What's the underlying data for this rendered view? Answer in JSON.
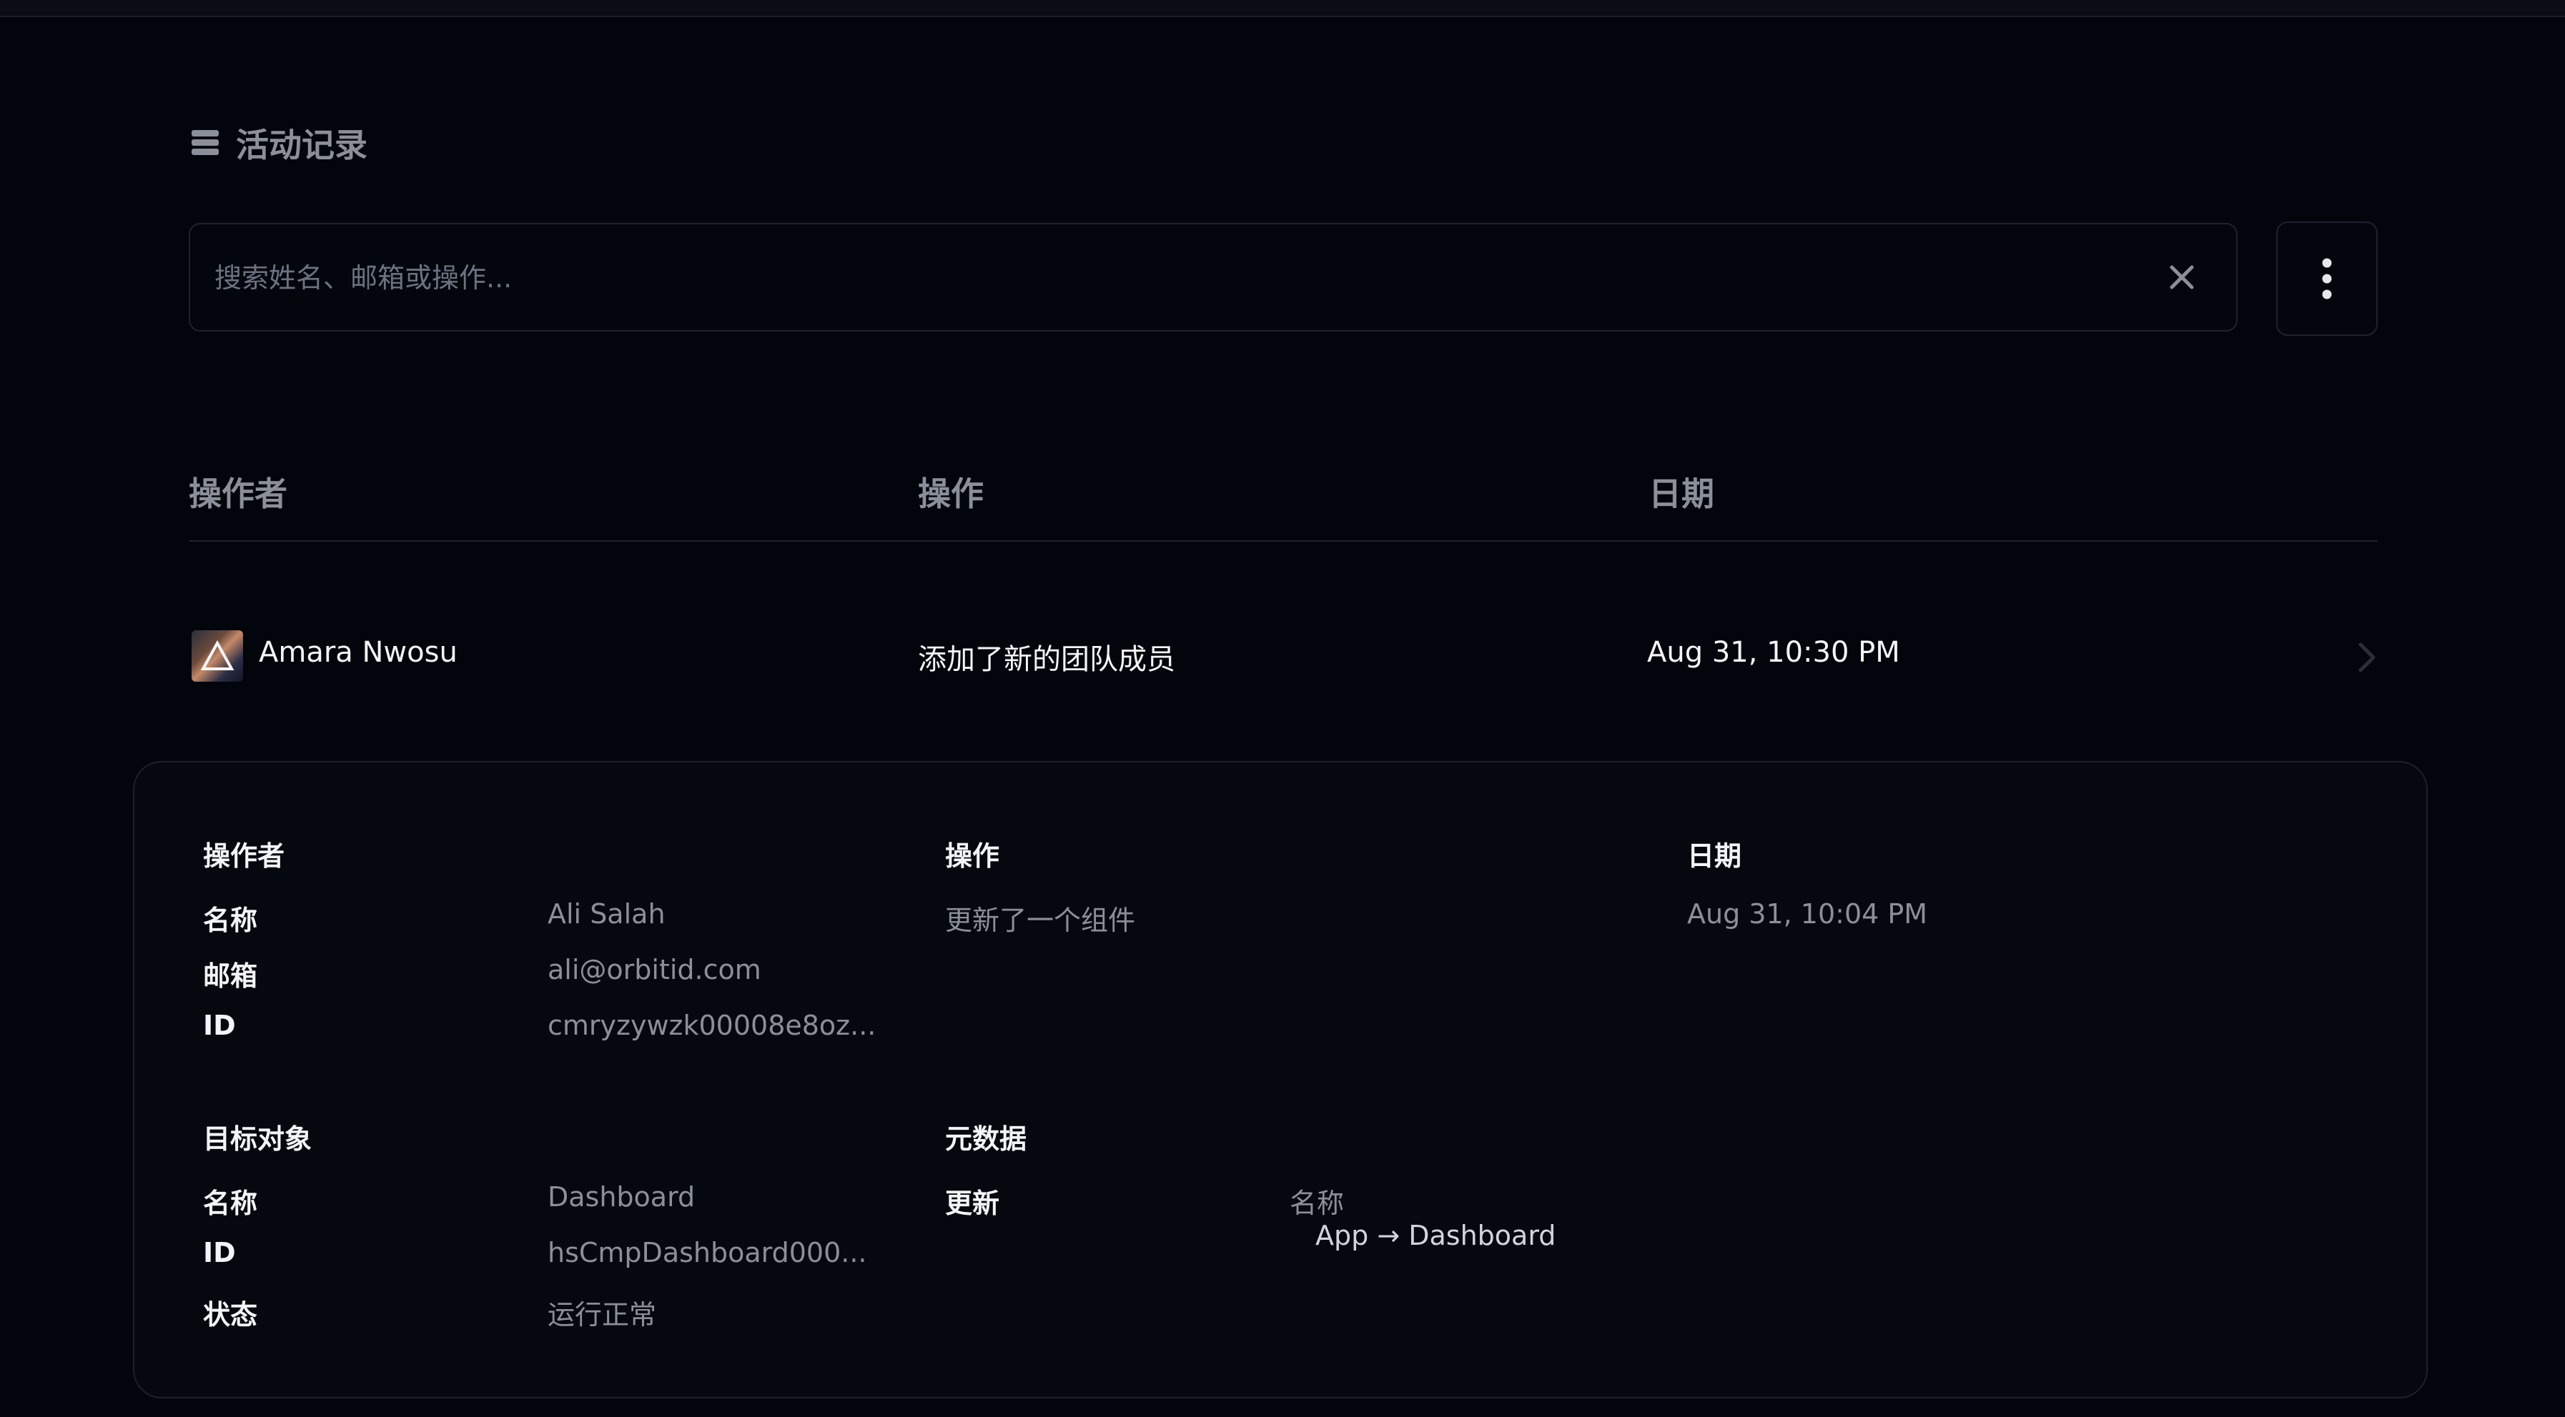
{
  "header": {
    "title": "活动记录",
    "icon": "database-icon"
  },
  "search": {
    "placeholder": "搜索姓名、邮箱或操作...",
    "value": "",
    "clear_icon": "close-icon"
  },
  "toolbar": {
    "more_icon": "more-vertical-icon"
  },
  "table": {
    "columns": [
      "操作者",
      "操作",
      "日期"
    ],
    "rows": [
      {
        "actor": "Amara Nwosu",
        "action": "添加了新的团队成员",
        "date": "Aug 31, 10:30 PM",
        "expand_icon": "chevron-right-icon"
      }
    ]
  },
  "detail": {
    "actor": {
      "heading": "操作者",
      "name_label": "名称",
      "name": "Ali Salah",
      "email_label": "邮箱",
      "email": "ali@orbitid.com",
      "id_label": "ID",
      "id": "cmryzywzk00008e8oz..."
    },
    "action": {
      "heading": "操作",
      "value": "更新了一个组件"
    },
    "date": {
      "heading": "日期",
      "value": "Aug 31, 10:04 PM"
    },
    "target": {
      "heading": "目标对象",
      "name_label": "名称",
      "name": "Dashboard",
      "id_label": "ID",
      "id": "hsCmpDashboard000...",
      "status_label": "状态",
      "status": "运行正常"
    },
    "metadata": {
      "heading": "元数据",
      "update_label": "更新",
      "field": "名称",
      "change": "App → Dashboard"
    }
  },
  "colors": {
    "background": "#03050c",
    "muted_text": "#8b8f99",
    "text": "#f3f4f6",
    "border": "#1e2230"
  }
}
